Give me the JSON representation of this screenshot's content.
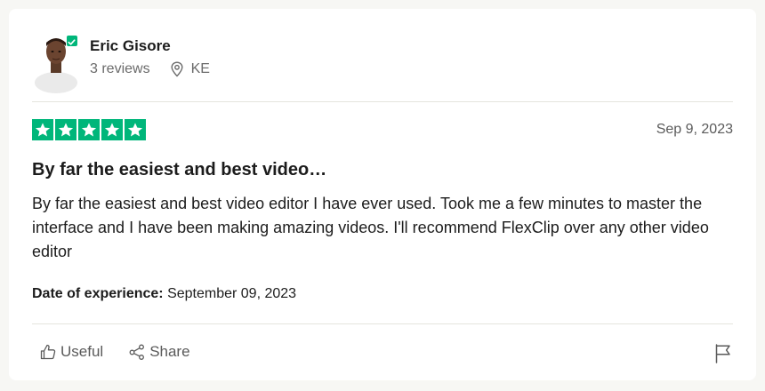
{
  "reviewer": {
    "name": "Eric Gisore",
    "reviews_count": "3 reviews",
    "country": "KE",
    "verified": true
  },
  "review": {
    "rating": 5,
    "rating_max": 5,
    "date": "Sep 9, 2023",
    "title": "By far the easiest and best video…",
    "body": "By far the easiest and best video editor I have ever used. Took me a few minutes to master the interface and I have been making amazing videos. I'll recommend FlexClip over any other video editor",
    "experience_label": "Date of experience:",
    "experience_date": "September 09, 2023"
  },
  "actions": {
    "useful_label": "Useful",
    "share_label": "Share"
  },
  "colors": {
    "star_green": "#00b67a",
    "text_dark": "#1c1c1c",
    "text_muted": "#6b6b6b"
  }
}
